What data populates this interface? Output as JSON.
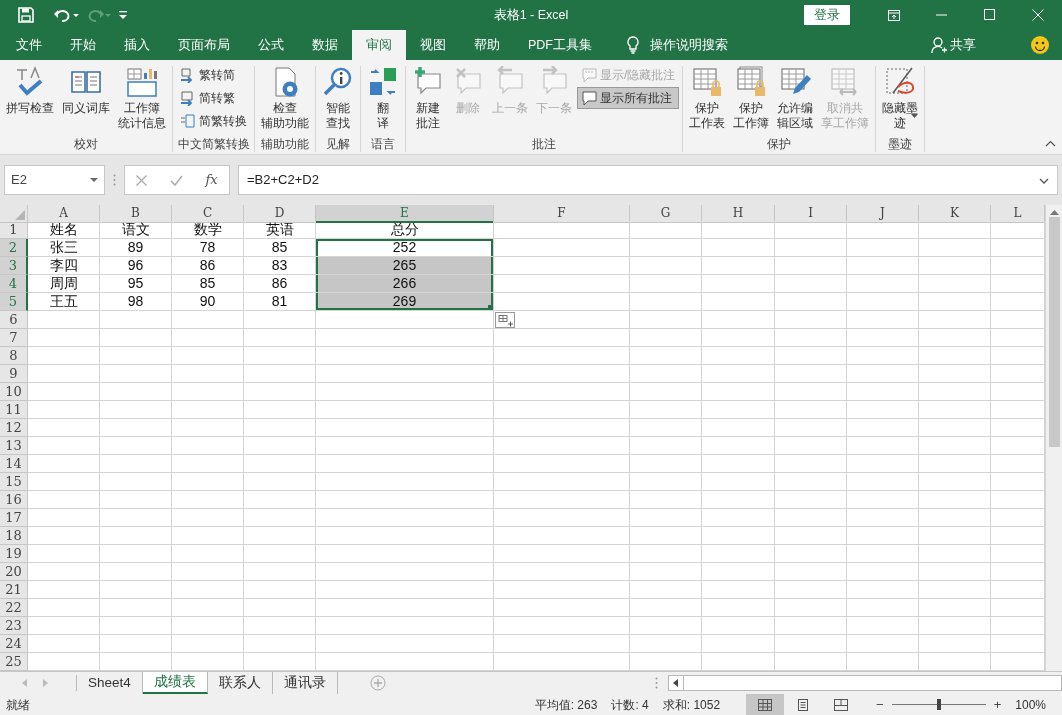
{
  "window": {
    "title": "表格1  -  Excel",
    "sign_in": "登录"
  },
  "tabs": [
    {
      "label": "文件",
      "selected": false
    },
    {
      "label": "开始",
      "selected": false
    },
    {
      "label": "插入",
      "selected": false
    },
    {
      "label": "页面布局",
      "selected": false
    },
    {
      "label": "公式",
      "selected": false
    },
    {
      "label": "数据",
      "selected": false
    },
    {
      "label": "审阅",
      "selected": true
    },
    {
      "label": "视图",
      "selected": false
    },
    {
      "label": "帮助",
      "selected": false
    },
    {
      "label": "PDF工具集",
      "selected": false
    }
  ],
  "tell_me": "操作说明搜索",
  "share": "共享",
  "ribbon": [
    {
      "label": "校对",
      "items": [
        {
          "kind": "large",
          "label": "拼写检查",
          "disabled": false,
          "on": false
        },
        {
          "kind": "large",
          "label": "同义词库",
          "disabled": false,
          "on": false
        },
        {
          "kind": "large",
          "lines": [
            "工作簿",
            "统计信息"
          ],
          "disabled": false,
          "on": false
        }
      ]
    },
    {
      "label": "中文简繁转换",
      "items": [
        {
          "kind": "small",
          "label": "繁转简",
          "disabled": false,
          "on": false
        },
        {
          "kind": "small",
          "label": "简转繁",
          "disabled": false,
          "on": false
        },
        {
          "kind": "small",
          "label": "简繁转换",
          "disabled": false,
          "on": false
        }
      ]
    },
    {
      "label": "辅助功能",
      "items": [
        {
          "kind": "large",
          "lines": [
            "检查",
            "辅助功能"
          ],
          "disabled": false,
          "on": false
        }
      ]
    },
    {
      "label": "见解",
      "items": [
        {
          "kind": "large",
          "lines": [
            "智能",
            "查找"
          ],
          "disabled": false,
          "on": false
        }
      ]
    },
    {
      "label": "语言",
      "items": [
        {
          "kind": "large",
          "lines": [
            "翻",
            "译"
          ],
          "disabled": false,
          "on": false
        }
      ]
    },
    {
      "label": "批注",
      "items": [
        {
          "kind": "large",
          "lines": [
            "新建",
            "批注"
          ],
          "disabled": false,
          "on": false
        },
        {
          "kind": "large",
          "label": "删除",
          "disabled": true,
          "on": false
        },
        {
          "kind": "large",
          "label": "上一条",
          "disabled": true,
          "on": false
        },
        {
          "kind": "large",
          "label": "下一条",
          "disabled": true,
          "on": false
        },
        {
          "kind": "small",
          "label": "显示/隐藏批注",
          "disabled": true,
          "on": false
        },
        {
          "kind": "small",
          "label": "显示所有批注",
          "disabled": false,
          "on": true
        }
      ]
    },
    {
      "label": "保护",
      "items": [
        {
          "kind": "large",
          "lines": [
            "保护",
            "工作表"
          ],
          "disabled": false,
          "on": false
        },
        {
          "kind": "large",
          "lines": [
            "保护",
            "工作簿"
          ],
          "disabled": false,
          "on": false
        },
        {
          "kind": "large",
          "lines": [
            "允许编",
            "辑区域"
          ],
          "disabled": false,
          "on": false
        },
        {
          "kind": "large",
          "lines": [
            "取消共",
            "享工作簿"
          ],
          "disabled": true,
          "on": false
        }
      ]
    },
    {
      "label": "墨迹",
      "items": [
        {
          "kind": "dropdown",
          "lines": [
            "隐藏墨",
            "迹"
          ],
          "disabled": false,
          "on": false
        }
      ]
    }
  ],
  "formula_bar": {
    "name_box": "E2",
    "function_label": "fx",
    "formula": "=B2+C2+D2"
  },
  "sheet": {
    "columns": [
      {
        "label": "A",
        "selected": false
      },
      {
        "label": "B",
        "selected": false
      },
      {
        "label": "C",
        "selected": false
      },
      {
        "label": "D",
        "selected": false
      },
      {
        "label": "E",
        "selected": true
      },
      {
        "label": "F",
        "selected": false
      },
      {
        "label": "G",
        "selected": false
      },
      {
        "label": "H",
        "selected": false
      },
      {
        "label": "I",
        "selected": false
      },
      {
        "label": "J",
        "selected": false
      },
      {
        "label": "K",
        "selected": false
      },
      {
        "label": "L",
        "selected": false
      }
    ],
    "rows": [
      {
        "label": "1",
        "selected": false,
        "cells": [
          {
            "text": "姓名",
            "selected": false,
            "active": false
          },
          {
            "text": "语文",
            "selected": false,
            "active": false
          },
          {
            "text": "数学",
            "selected": false,
            "active": false
          },
          {
            "text": "英语",
            "selected": false,
            "active": false
          },
          {
            "text": "总分",
            "selected": false,
            "active": false
          }
        ]
      },
      {
        "label": "2",
        "selected": true,
        "cells": [
          {
            "text": "张三",
            "selected": false,
            "active": false
          },
          {
            "text": "89",
            "selected": false,
            "active": false
          },
          {
            "text": "78",
            "selected": false,
            "active": false
          },
          {
            "text": "85",
            "selected": false,
            "active": false
          },
          {
            "text": "252",
            "selected": true,
            "active": true
          }
        ]
      },
      {
        "label": "3",
        "selected": true,
        "cells": [
          {
            "text": "李四",
            "selected": false,
            "active": false
          },
          {
            "text": "96",
            "selected": false,
            "active": false
          },
          {
            "text": "86",
            "selected": false,
            "active": false
          },
          {
            "text": "83",
            "selected": false,
            "active": false
          },
          {
            "text": "265",
            "selected": true,
            "active": false
          }
        ]
      },
      {
        "label": "4",
        "selected": true,
        "cells": [
          {
            "text": "周周",
            "selected": false,
            "active": false
          },
          {
            "text": "95",
            "selected": false,
            "active": false
          },
          {
            "text": "85",
            "selected": false,
            "active": false
          },
          {
            "text": "86",
            "selected": false,
            "active": false
          },
          {
            "text": "266",
            "selected": true,
            "active": false
          }
        ]
      },
      {
        "label": "5",
        "selected": true,
        "cells": [
          {
            "text": "王五",
            "selected": false,
            "active": false
          },
          {
            "text": "98",
            "selected": false,
            "active": false
          },
          {
            "text": "90",
            "selected": false,
            "active": false
          },
          {
            "text": "81",
            "selected": false,
            "active": false
          },
          {
            "text": "269",
            "selected": true,
            "active": false
          }
        ]
      },
      {
        "label": "6",
        "selected": false
      },
      {
        "label": "7",
        "selected": false
      },
      {
        "label": "8",
        "selected": false
      },
      {
        "label": "9",
        "selected": false
      },
      {
        "label": "10",
        "selected": false
      },
      {
        "label": "11",
        "selected": false
      },
      {
        "label": "12",
        "selected": false
      },
      {
        "label": "13",
        "selected": false
      },
      {
        "label": "14",
        "selected": false
      },
      {
        "label": "15",
        "selected": false
      },
      {
        "label": "16",
        "selected": false
      },
      {
        "label": "17",
        "selected": false
      },
      {
        "label": "18",
        "selected": false
      },
      {
        "label": "19",
        "selected": false
      },
      {
        "label": "20",
        "selected": false
      },
      {
        "label": "21",
        "selected": false
      },
      {
        "label": "22",
        "selected": false
      },
      {
        "label": "23",
        "selected": false
      },
      {
        "label": "24",
        "selected": false
      },
      {
        "label": "25",
        "selected": false
      }
    ]
  },
  "sheet_tabs": [
    {
      "label": "Sheet4",
      "selected": false
    },
    {
      "label": "成绩表",
      "selected": true
    },
    {
      "label": "联系人",
      "selected": false
    },
    {
      "label": "通讯录",
      "selected": false
    }
  ],
  "status_bar": {
    "ready": "就绪",
    "average": "平均值: 263",
    "count": "计数: 4",
    "sum": "求和: 1052",
    "views": [
      {
        "kind": "normal",
        "selected": true
      },
      {
        "kind": "page_layout",
        "selected": false
      },
      {
        "kind": "page_break",
        "selected": false
      }
    ],
    "zoom_out": "−",
    "zoom": {
      "level": 0.5
    },
    "zoom_in": "+",
    "zoom_label": "100%"
  }
}
